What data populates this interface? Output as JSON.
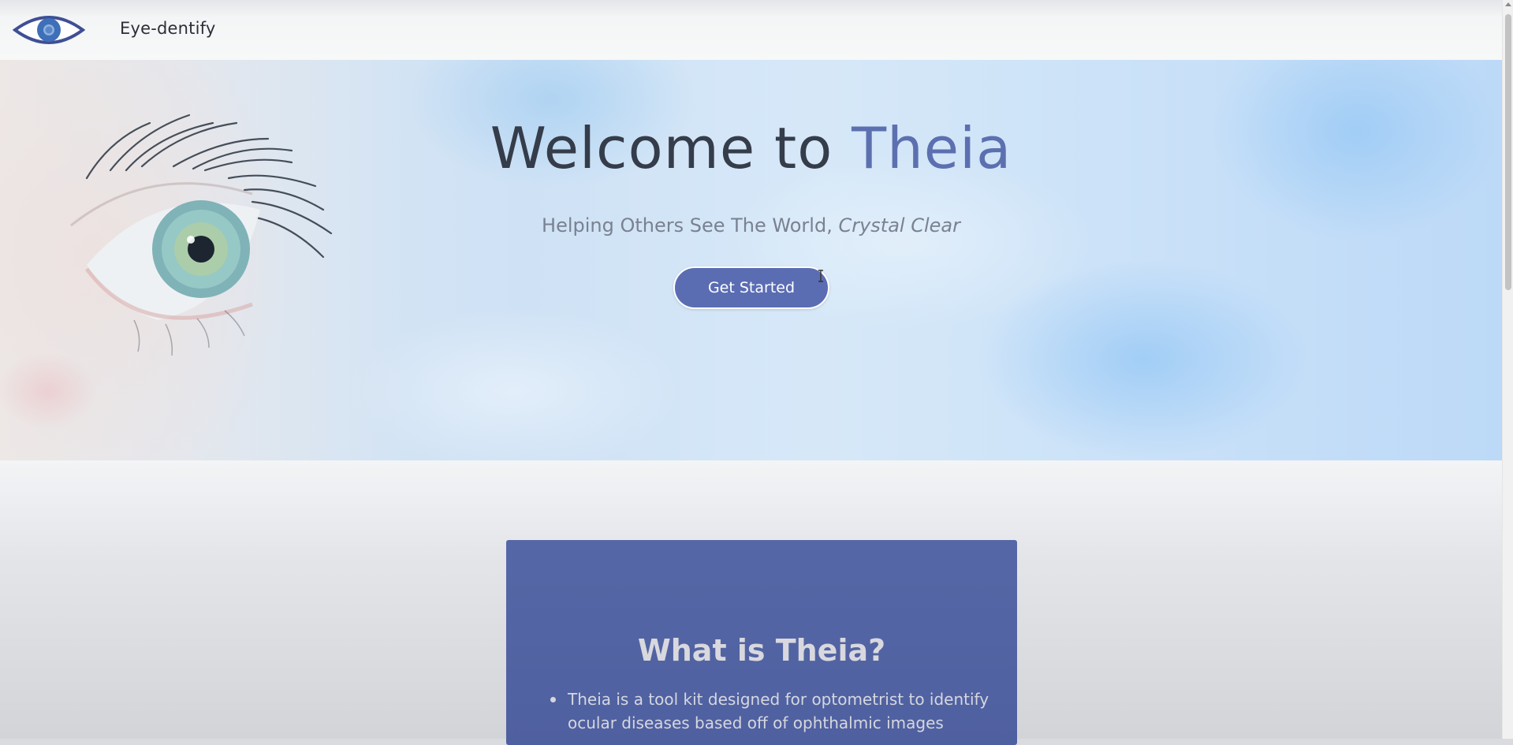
{
  "navbar": {
    "brand": "Eye-dentify",
    "logo_icon": "eye-icon"
  },
  "hero": {
    "title_prefix": "Welcome to ",
    "title_accent": "Theia",
    "subtitle_plain": "Helping Others See The World, ",
    "subtitle_italic": "Crystal Clear",
    "cta_label": "Get Started"
  },
  "about": {
    "title": "What is Theia?",
    "bullets": [
      "Theia is a tool kit designed for optometrist to identify ocular diseases based off of ophthalmic images"
    ]
  },
  "colors": {
    "accent": "#5c70b0",
    "button": "#5a6db3",
    "card": "#5567a6",
    "title_dark": "#353c4a"
  }
}
